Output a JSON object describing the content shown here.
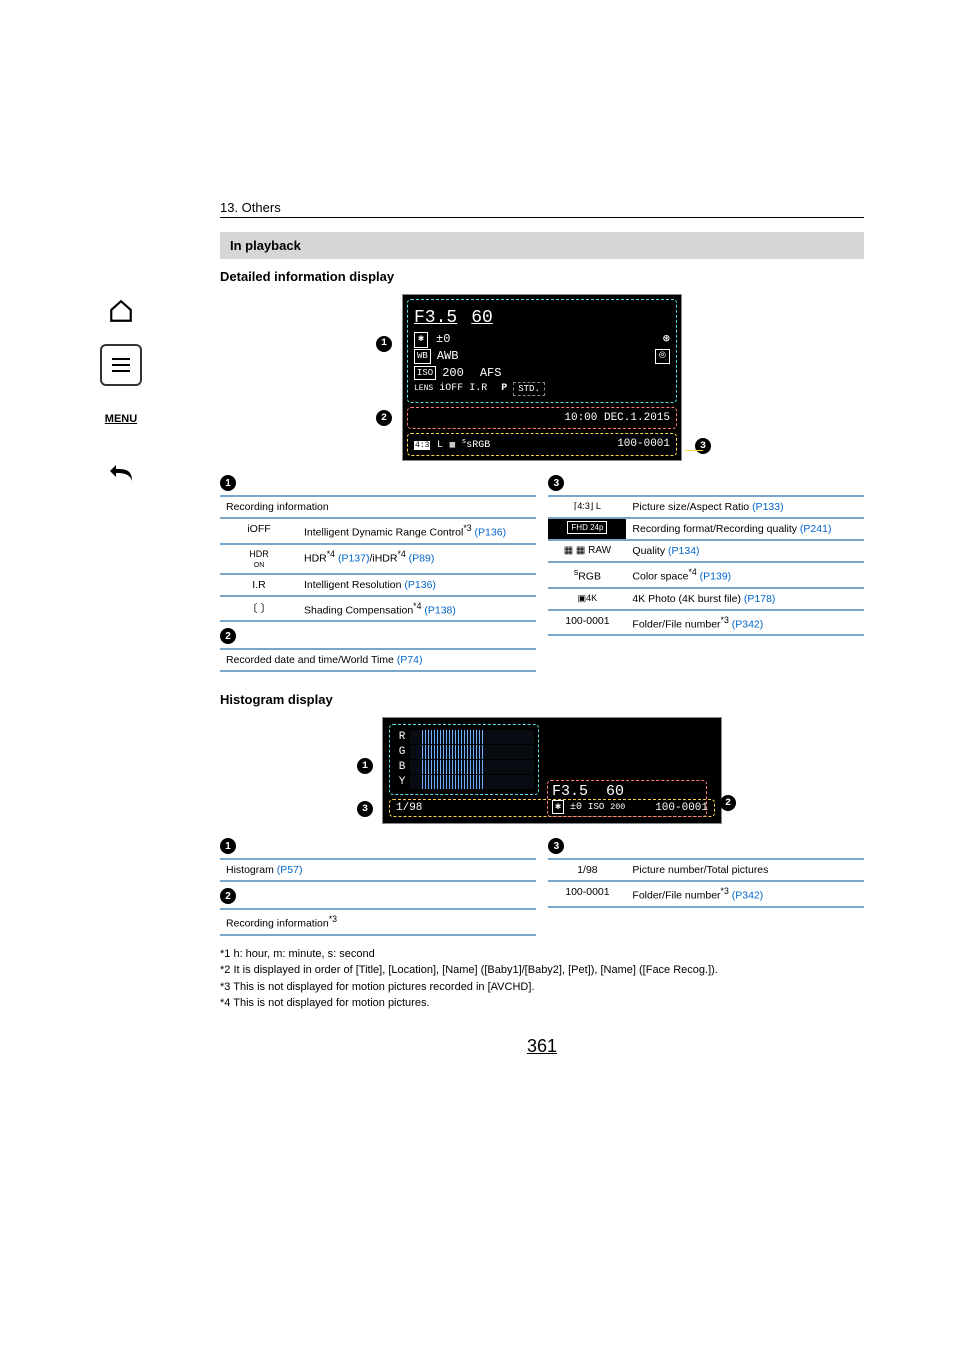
{
  "chapter": "13. Others",
  "section_title": "In playback",
  "subhead1": "Detailed information display",
  "subhead2": "Histogram display",
  "sidebar": {
    "home": "⌂",
    "toc": "≡",
    "menu": "MENU",
    "back": "↶"
  },
  "fig1": {
    "aperture": "F3.5",
    "shutter": "60",
    "ev_label": "±0",
    "wb_box": "WB",
    "wb_val": "AWB",
    "iso_box": "ISO",
    "iso_val": "200",
    "afs": "AFS",
    "lens": "LENS",
    "ioff": "iOFF",
    "ir": "I.R",
    "p": "P",
    "std": "STD.",
    "datetime": "10:00  DEC.1.2015",
    "ratio": "4:3",
    "size": "L",
    "qual": "",
    "srgb": "sRGB",
    "filenum": "100-0001"
  },
  "tables_fig1": {
    "col1": {
      "h1": "Recording information",
      "r1_icon": "iOFF",
      "r1_txt_a": "Intelligent Dynamic Range Control",
      "r1_sup": "*3",
      "r1_link": "(P136)",
      "r2_icon": "HDR ON",
      "r2_txt_a": "HDR",
      "r2_sup1": "*4",
      "r2_link1": "(P137)",
      "r2_txt_b": "/iHDR",
      "r2_sup2": "*4",
      "r2_link2": "(P89)",
      "r3_icon": "I.R",
      "r3_txt": "Intelligent Resolution ",
      "r3_link": "(P136)",
      "r4_icon": "〔 〕",
      "r4_txt_a": "Shading Compensation",
      "r4_sup": "*4",
      "r4_link": "(P138)",
      "h2": "Recorded date and time/World Time ",
      "h2_link": "(P74)"
    },
    "col3": {
      "r1_icon": "4:3 L",
      "r1_txt": "Picture size/Aspect Ratio ",
      "r1_link": "(P133)",
      "r2_icon": "FHD 24p",
      "r2_txt": "Recording format/Recording quality ",
      "r2_link": "(P241)",
      "r3_icon": "RAW",
      "r3_pre": "",
      "r3_txt": "Quality ",
      "r3_link": "(P134)",
      "r4_icon": "sRGB",
      "r4_txt": "Color space",
      "r4_sup": "*4",
      "r4_link": "(P139)",
      "r5_icon": "4K",
      "r5_txt": "4K Photo (4K burst file) ",
      "r5_link": "(P178)",
      "r6_icon": "100-0001",
      "r6_txt": "Folder/File number",
      "r6_sup": "*3",
      "r6_link": "(P342)"
    }
  },
  "fig2": {
    "R": "R",
    "G": "G",
    "B": "B",
    "Y": "Y",
    "aperture": "F3.5",
    "shutter": "60",
    "ev": "±0",
    "iso_lab": "ISO",
    "iso_val": "200",
    "counter": "1/98",
    "filenum": "100-0001"
  },
  "tables_fig2": {
    "col1": {
      "h1": "Histogram ",
      "h1_link": "(P57)",
      "h2": "Recording information",
      "h2_sup": "*3"
    },
    "col3": {
      "r1_icon": "1/98",
      "r1_txt": "Picture number/Total pictures",
      "r2_icon": "100-0001",
      "r2_txt": "Folder/File number",
      "r2_sup": "*3",
      "r2_link": "(P342)"
    }
  },
  "footnotes": {
    "f1": "*1 h: hour, m: minute, s: second",
    "f2": "*2 It is displayed in order of [Title], [Location], [Name] ([Baby1]/[Baby2], [Pet]), [Name] ([Face Recog.]).",
    "f3": "*3 This is not displayed for motion pictures recorded in [AVCHD].",
    "f4": "*4 This is not displayed for motion pictures."
  },
  "page_number": "361",
  "callouts": {
    "c1": "1",
    "c2": "2",
    "c3": "3"
  }
}
